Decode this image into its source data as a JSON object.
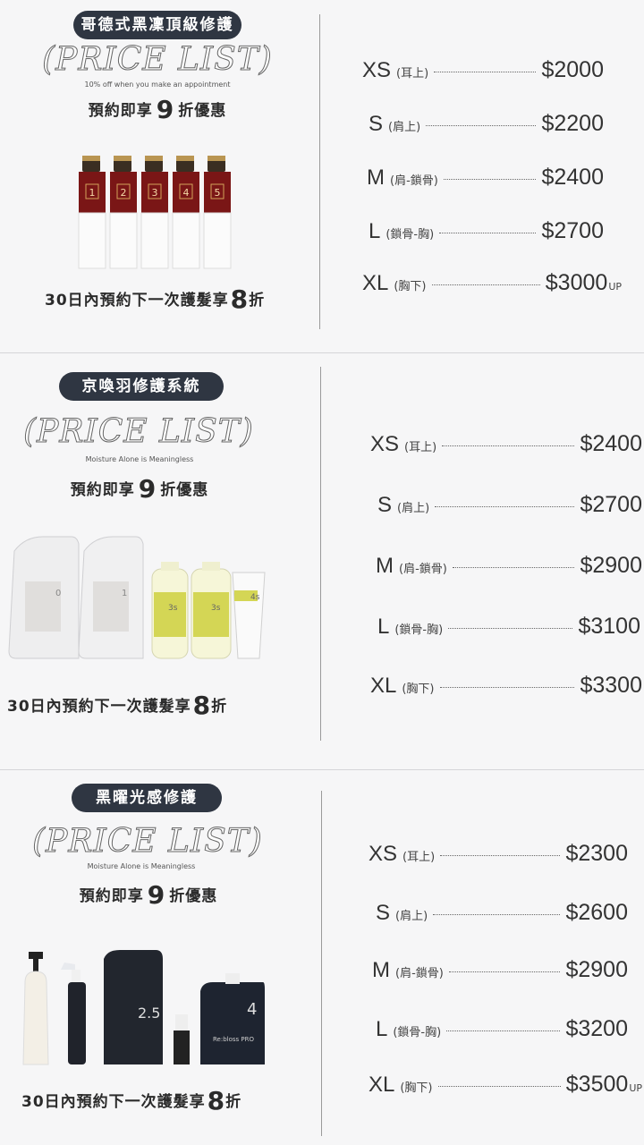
{
  "sections": [
    {
      "badge": "哥德式黑凜頂級修護",
      "price_list": "(PRICE LIST)",
      "subtitle": "10% off when you make an appointment",
      "discount_pre": "預約即享",
      "discount_num": "9",
      "discount_post": "折優惠",
      "next_pre": "30日內預約下一次護髮享",
      "next_num": "8",
      "next_post": "折",
      "prices": [
        {
          "size": "XS",
          "range": "(耳上)",
          "price": "$2000",
          "up": ""
        },
        {
          "size": "S",
          "range": "(肩上)",
          "price": "$2200",
          "up": ""
        },
        {
          "size": "M",
          "range": "(肩-鎖骨)",
          "price": "$2400",
          "up": ""
        },
        {
          "size": "L",
          "range": "(鎖骨-胸)",
          "price": "$2700",
          "up": ""
        },
        {
          "size": "XL",
          "range": "(胸下)",
          "price": "$3000",
          "up": "UP"
        }
      ],
      "bottle_numbers": [
        "1",
        "2",
        "3",
        "4",
        "5"
      ]
    },
    {
      "badge": "京喚羽修護系統",
      "price_list": "(PRICE LIST)",
      "subtitle": "Moisture Alone is Meaningless",
      "discount_pre": "預約即享",
      "discount_num": "9",
      "discount_post": "折優惠",
      "next_pre": "30日內預約下一次護髮享",
      "next_num": "8",
      "next_post": "折",
      "prices": [
        {
          "size": "XS",
          "range": "(耳上)",
          "price": "$2400",
          "up": ""
        },
        {
          "size": "S",
          "range": "(肩上)",
          "price": "$2700",
          "up": ""
        },
        {
          "size": "M",
          "range": "(肩-鎖骨)",
          "price": "$2900",
          "up": ""
        },
        {
          "size": "L",
          "range": "(鎖骨-胸)",
          "price": "$3100",
          "up": ""
        },
        {
          "size": "XL",
          "range": "(胸下)",
          "price": "$3300",
          "up": ""
        }
      ],
      "product_numbers": [
        "0",
        "1",
        "3s",
        "3s",
        "4s"
      ]
    },
    {
      "badge": "黑曜光感修護",
      "price_list": "(PRICE LIST)",
      "subtitle": "Moisture Alone is Meaningless",
      "discount_pre": "預約即享",
      "discount_num": "9",
      "discount_post": "折優惠",
      "next_pre": "30日內預約下一次護髮享",
      "next_num": "8",
      "next_post": "折",
      "prices": [
        {
          "size": "XS",
          "range": "(耳上)",
          "price": "$2300",
          "up": ""
        },
        {
          "size": "S",
          "range": "(肩上)",
          "price": "$2600",
          "up": ""
        },
        {
          "size": "M",
          "range": "(肩-鎖骨)",
          "price": "$2900",
          "up": ""
        },
        {
          "size": "L",
          "range": "(鎖骨-胸)",
          "price": "$3200",
          "up": ""
        },
        {
          "size": "XL",
          "range": "(胸下)",
          "price": "$3500",
          "up": "UP"
        }
      ],
      "product_numbers": [
        "2.5",
        "4"
      ],
      "brand": "Re:bloss PRO"
    }
  ]
}
